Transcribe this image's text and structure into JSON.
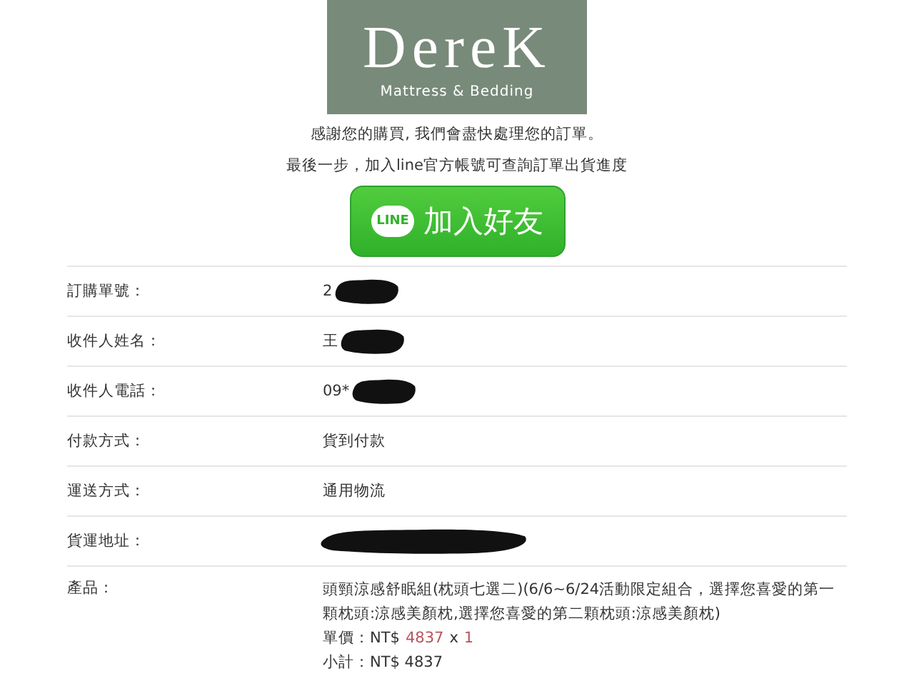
{
  "logo": {
    "name": "DereK",
    "tagline": "Mattress & Bedding"
  },
  "thanks": "感謝您的購買, 我們會盡快處理您的訂單。",
  "hint": "最後一步，加入line官方帳號可查詢訂單出貨進度",
  "line_button": {
    "badge": "LINE",
    "label": "加入好友"
  },
  "rows": [
    {
      "label": "訂購單號：",
      "value": "2",
      "redacted": true
    },
    {
      "label": "收件人姓名：",
      "value": "王",
      "redacted": true
    },
    {
      "label": "收件人電話：",
      "value": "09*",
      "redacted": true
    },
    {
      "label": "付款方式：",
      "value": "貨到付款",
      "redacted": false
    },
    {
      "label": "運送方式：",
      "value": "通用物流",
      "redacted": false
    },
    {
      "label": "貨運地址：",
      "value": "",
      "redacted": true
    }
  ],
  "product": {
    "label": "產品：",
    "name": "頭頸涼感舒眠組(枕頭七選二)(6/6~6/24活動限定組合，選擇您喜愛的第一顆枕頭:涼感美顏枕,選擇您喜愛的第二顆枕頭:涼感美顏枕)",
    "price_label": "單價：NT$",
    "price": "4837",
    "times": "x",
    "quantity": "1",
    "subtotal": "小計：NT$ 4837"
  }
}
